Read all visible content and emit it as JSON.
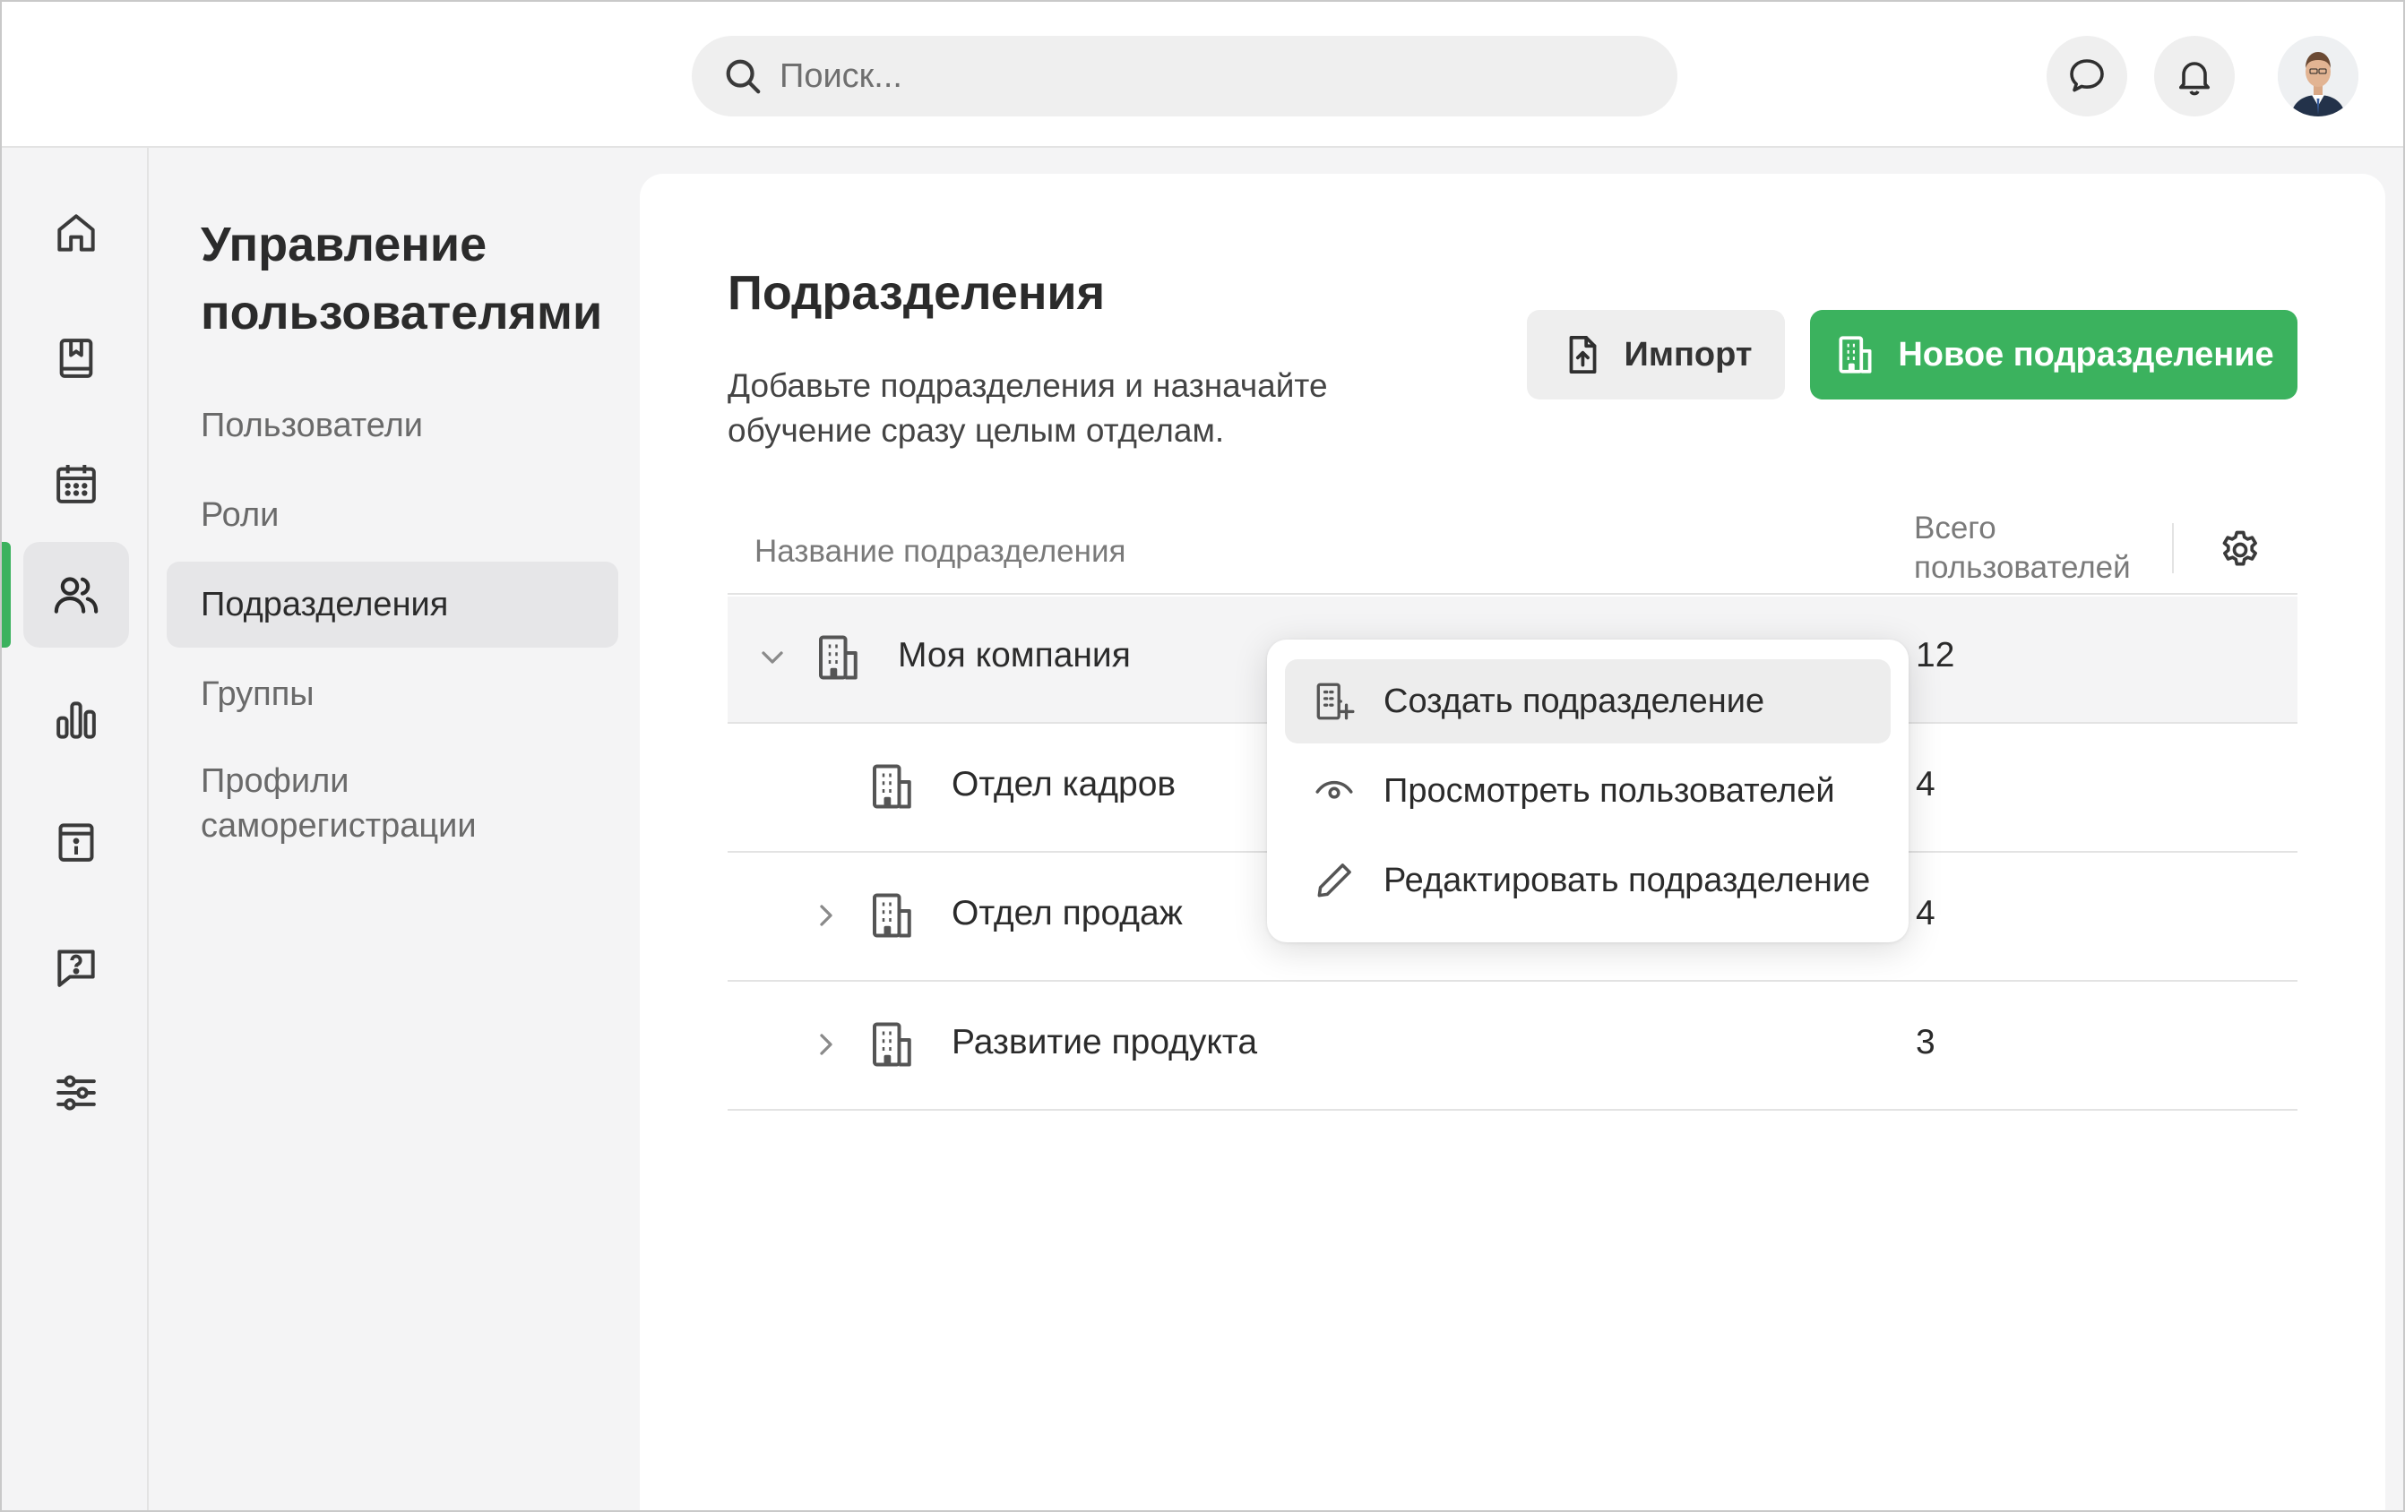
{
  "search": {
    "placeholder": "Поиск..."
  },
  "header": {
    "icons": [
      "chat-icon",
      "bell-icon"
    ],
    "avatar": "user-avatar"
  },
  "rail": {
    "items": [
      "home-icon",
      "book-icon",
      "calendar-icon",
      "users-icon",
      "bar-chart-icon",
      "info-icon",
      "help-icon",
      "sliders-icon"
    ],
    "active": "users-icon",
    "accent": "#3bb25e"
  },
  "subnav": {
    "title": "Управление пользователями",
    "items": [
      {
        "label": "Пользователи"
      },
      {
        "label": "Роли"
      },
      {
        "label": "Подразделения"
      },
      {
        "label": "Группы"
      },
      {
        "label": "Профили саморегистрации"
      }
    ],
    "active": "Подразделения"
  },
  "main": {
    "title": "Подразделения",
    "description": "Добавьте подразделения и назначайте обучение сразу целым отделам.",
    "import_label": "Импорт",
    "new_label": "Новое подразделение",
    "columns": {
      "name": "Название подразделения",
      "total": "Всего пользователей"
    },
    "rows": [
      {
        "name": "Моя компания",
        "count": "12",
        "expander": "expanded"
      },
      {
        "name": "Отдел кадров",
        "count": "4",
        "expander": "none"
      },
      {
        "name": "Отдел продаж",
        "count": "4",
        "expander": "collapsed"
      },
      {
        "name": "Развитие продукта",
        "count": "3",
        "expander": "collapsed"
      }
    ]
  },
  "menu": {
    "items": [
      {
        "label": "Создать подразделение",
        "icon": "building-add-icon"
      },
      {
        "label": "Просмотреть пользователей",
        "icon": "eye-icon"
      },
      {
        "label": "Редактировать подразделение",
        "icon": "pencil-icon"
      }
    ]
  }
}
